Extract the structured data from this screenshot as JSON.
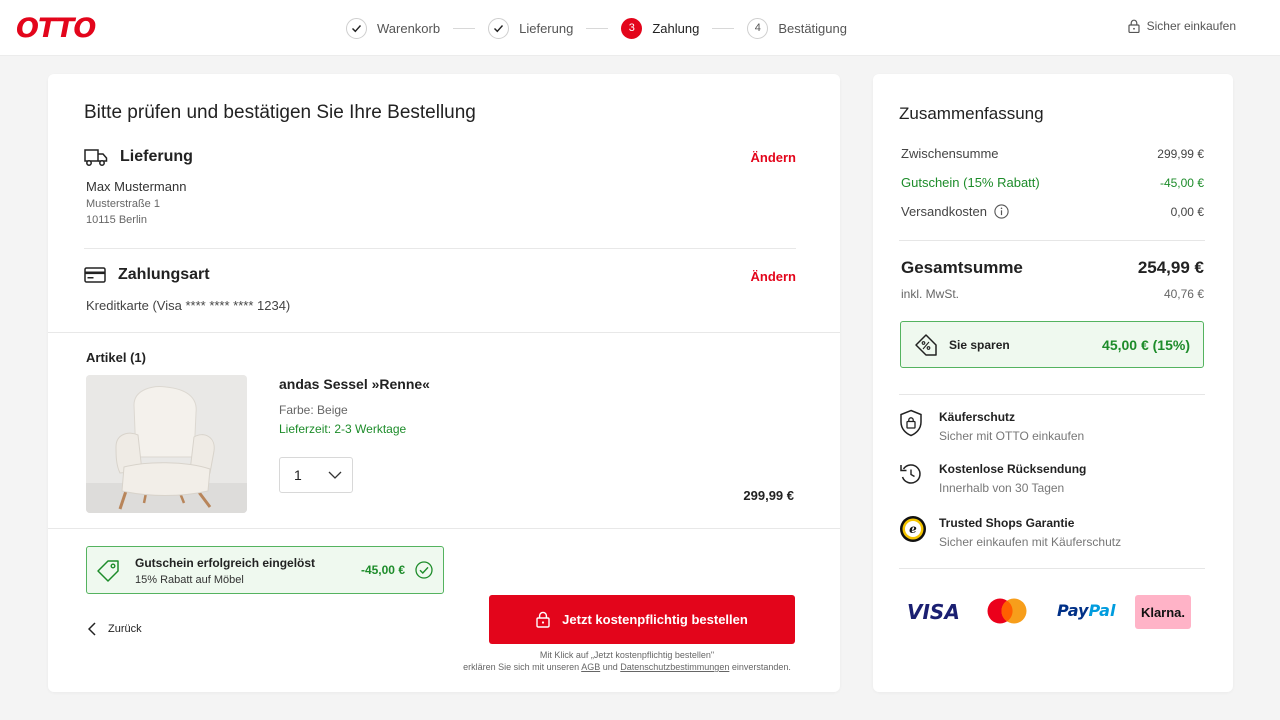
{
  "header": {
    "logo": "OTTO",
    "steps": [
      {
        "number": "",
        "label": "Warenkorb",
        "state": "done"
      },
      {
        "number": "",
        "label": "Lieferung",
        "state": "done"
      },
      {
        "number": "3",
        "label": "Zahlung",
        "state": "active"
      },
      {
        "number": "4",
        "label": "Bestätigung",
        "state": "pending"
      }
    ],
    "secure_label": "Sicher einkaufen"
  },
  "main": {
    "title": "Bitte prüfen und bestätigen Sie Ihre Bestellung",
    "delivery": {
      "title": "Lieferung",
      "change_label": "Ändern",
      "name": "Max Mustermann",
      "street": "Musterstraße 1",
      "city": "10115 Berlin"
    },
    "payment": {
      "title": "Zahlungsart",
      "change_label": "Ändern",
      "method": "Kreditkarte (Visa **** **** **** 1234)"
    },
    "articles": {
      "heading": "Artikel (1)",
      "item": {
        "name": "andas Sessel »Renne«",
        "color": "Farbe: Beige",
        "delivery": "Lieferzeit: 2-3 Werktage",
        "quantity": "1",
        "price": "299,99 €"
      }
    },
    "voucher": {
      "title": "Gutschein erfolgreich eingelöst",
      "subtitle": "15% Rabatt auf Möbel",
      "amount": "-45,00 €"
    },
    "back_label": "Zurück",
    "order_button": "Jetzt kostenpflichtig bestellen",
    "legal": {
      "line1": "Mit Klick auf „Jetzt kostenpflichtig bestellen\"",
      "line2_pre": "erklären Sie sich mit unseren",
      "agb": "AGB",
      "and": "und",
      "privacy": "Datenschutzbestimmungen",
      "line2_post": "einverstanden."
    }
  },
  "summary": {
    "title": "Zusammenfassung",
    "subtotal_label": "Zwischensumme",
    "subtotal_value": "299,99 €",
    "voucher_label": "Gutschein (15% Rabatt)",
    "voucher_value": "-45,00 €",
    "shipping_label": "Versandkosten",
    "shipping_value": "0,00 €",
    "total_label": "Gesamtsumme",
    "total_value": "254,99 €",
    "vat_label": "inkl. MwSt.",
    "vat_value": "40,76 €",
    "savings_label": "Sie sparen",
    "savings_value": "45,00 € (15%)",
    "features": [
      {
        "title": "Käuferschutz",
        "subtitle": "Sicher mit OTTO einkaufen"
      },
      {
        "title": "Kostenlose Rücksendung",
        "subtitle": "Innerhalb von 30 Tagen"
      },
      {
        "title": "Trusted Shops Garantie",
        "subtitle": "Sicher einkaufen mit Käuferschutz"
      }
    ],
    "payment_logos": {
      "visa": "VISA",
      "paypal_a": "Pay",
      "paypal_b": "Pal",
      "klarna": "Klarna."
    }
  },
  "colors": {
    "brand": "#e3051b",
    "success": "#1d8c2a",
    "success_bg": "#eff9ef"
  }
}
